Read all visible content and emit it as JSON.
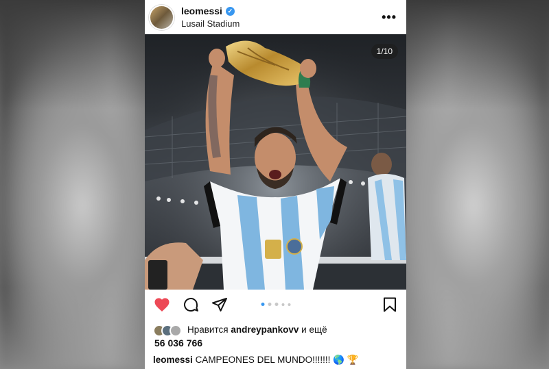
{
  "post": {
    "username": "leomessi",
    "location": "Lusail Stadium",
    "verified_glyph": "✓",
    "more_glyph": "•••",
    "media_counter": "1/10",
    "likes": {
      "prefix": "Нравится",
      "liker": "andreypankovv",
      "suffix": "и ещё",
      "count": "56 036 766"
    },
    "caption": {
      "author": "leomessi",
      "text": "CAMPEONES DEL MUNDO!!!!!!!",
      "emoji": "🌎 🏆"
    },
    "carousel": {
      "current": 1,
      "total": 10
    }
  },
  "icons": {
    "like": "heart-icon",
    "comment": "comment-icon",
    "share": "send-icon",
    "save": "bookmark-icon"
  },
  "colors": {
    "like_active": "#ed4956",
    "verified": "#3897f0",
    "dot_active": "#3897f0"
  }
}
